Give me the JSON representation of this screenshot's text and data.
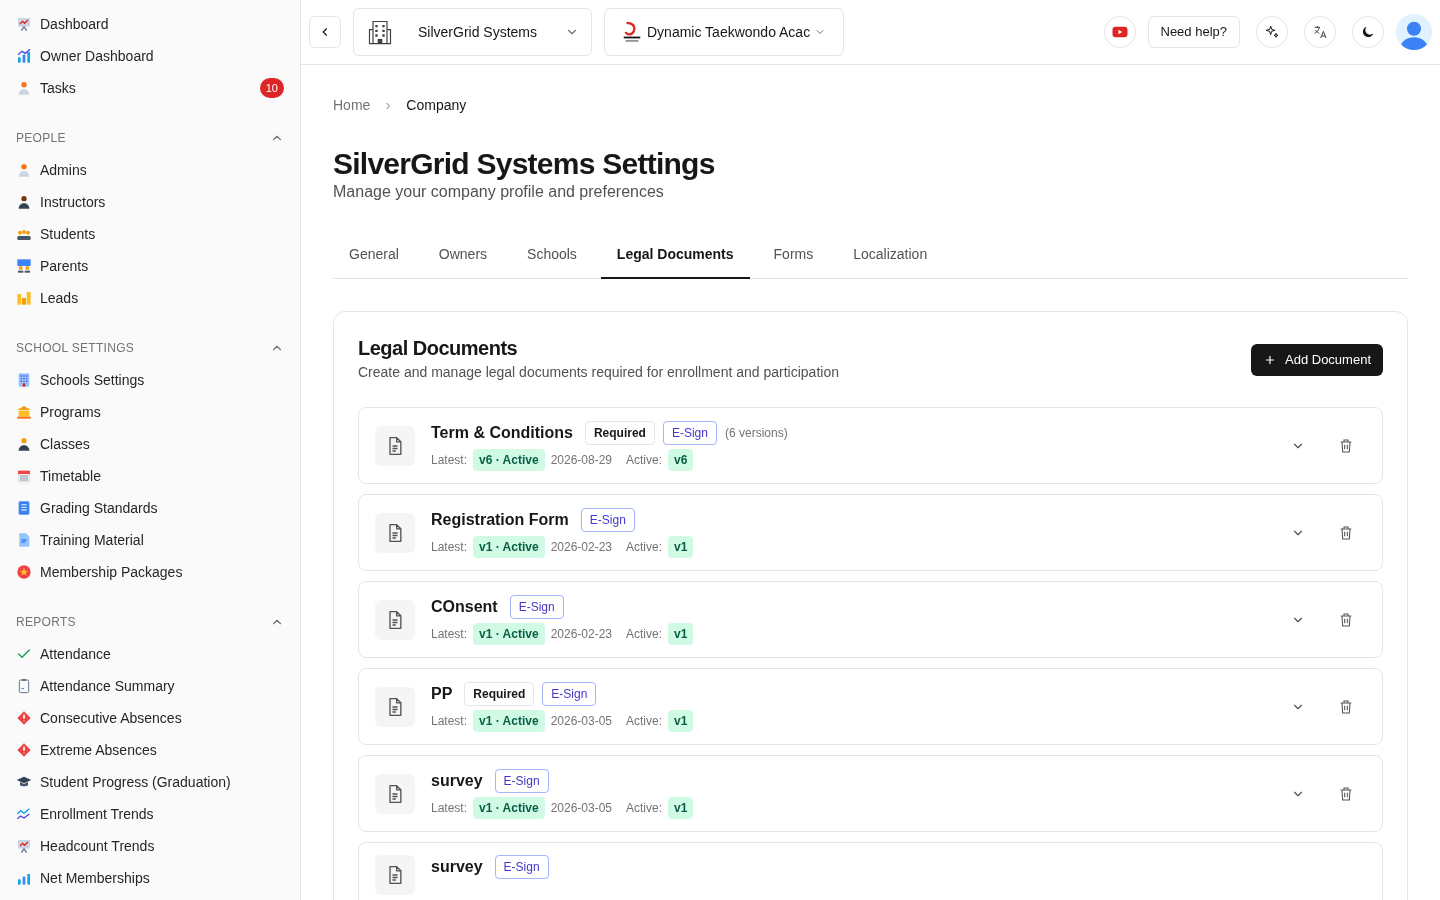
{
  "sidebar": {
    "top_items": [
      {
        "label": "Dashboard"
      },
      {
        "label": "Owner Dashboard"
      },
      {
        "label": "Tasks",
        "badge": "10"
      }
    ],
    "sections": [
      {
        "title": "PEOPLE",
        "expanded": true,
        "items": [
          {
            "label": "Admins"
          },
          {
            "label": "Instructors"
          },
          {
            "label": "Students"
          },
          {
            "label": "Parents"
          },
          {
            "label": "Leads"
          }
        ]
      },
      {
        "title": "SCHOOL SETTINGS",
        "expanded": true,
        "items": [
          {
            "label": "Schools Settings"
          },
          {
            "label": "Programs"
          },
          {
            "label": "Classes"
          },
          {
            "label": "Timetable"
          },
          {
            "label": "Grading Standards"
          },
          {
            "label": "Training Material"
          },
          {
            "label": "Membership Packages"
          }
        ]
      },
      {
        "title": "REPORTS",
        "expanded": true,
        "items": [
          {
            "label": "Attendance"
          },
          {
            "label": "Attendance Summary"
          },
          {
            "label": "Consecutive Absences"
          },
          {
            "label": "Extreme Absences"
          },
          {
            "label": "Student Progress (Graduation)"
          },
          {
            "label": "Enrollment Trends"
          },
          {
            "label": "Headcount Trends"
          },
          {
            "label": "Net Memberships"
          }
        ]
      }
    ]
  },
  "header": {
    "company": "SilverGrid Systems",
    "school": "Dynamic Taekwondo Acac",
    "help": "Need help?"
  },
  "breadcrumb": [
    "Home",
    "Company"
  ],
  "page": {
    "title": "SilverGrid Systems Settings",
    "subtitle": "Manage your company profile and preferences"
  },
  "tabs": [
    {
      "label": "General",
      "selected": false
    },
    {
      "label": "Owners",
      "selected": false
    },
    {
      "label": "Schools",
      "selected": false
    },
    {
      "label": "Legal Documents",
      "selected": true
    },
    {
      "label": "Forms",
      "selected": false
    },
    {
      "label": "Localization",
      "selected": false
    }
  ],
  "panel": {
    "title": "Legal Documents",
    "description": "Create and manage legal documents required for enrollment and participation",
    "add_button": "Add Document"
  },
  "documents": [
    {
      "name": "Term & Conditions",
      "badges": [
        {
          "kind": "required",
          "label": "Required"
        },
        {
          "kind": "esign",
          "label": "E-Sign"
        }
      ],
      "versions": "(6 versions)",
      "latest_label": "Latest:",
      "latest": "v6 · Active",
      "date": "2026-08-29",
      "active_label": "Active:",
      "active": "v6"
    },
    {
      "name": "Registration Form",
      "badges": [
        {
          "kind": "esign",
          "label": "E-Sign"
        }
      ],
      "latest_label": "Latest:",
      "latest": "v1 · Active",
      "date": "2026-02-23",
      "active_label": "Active:",
      "active": "v1"
    },
    {
      "name": "COnsent",
      "badges": [
        {
          "kind": "esign",
          "label": "E-Sign"
        }
      ],
      "latest_label": "Latest:",
      "latest": "v1 · Active",
      "date": "2026-02-23",
      "active_label": "Active:",
      "active": "v1"
    },
    {
      "name": "PP",
      "badges": [
        {
          "kind": "required",
          "label": "Required"
        },
        {
          "kind": "esign",
          "label": "E-Sign"
        }
      ],
      "latest_label": "Latest:",
      "latest": "v1 · Active",
      "date": "2026-03-05",
      "active_label": "Active:",
      "active": "v1"
    },
    {
      "name": "survey",
      "badges": [
        {
          "kind": "esign",
          "label": "E-Sign"
        }
      ],
      "latest_label": "Latest:",
      "latest": "v1 · Active",
      "date": "2026-03-05",
      "active_label": "Active:",
      "active": "v1"
    },
    {
      "name": "survey",
      "badges": [
        {
          "kind": "esign",
          "label": "E-Sign"
        }
      ]
    }
  ]
}
